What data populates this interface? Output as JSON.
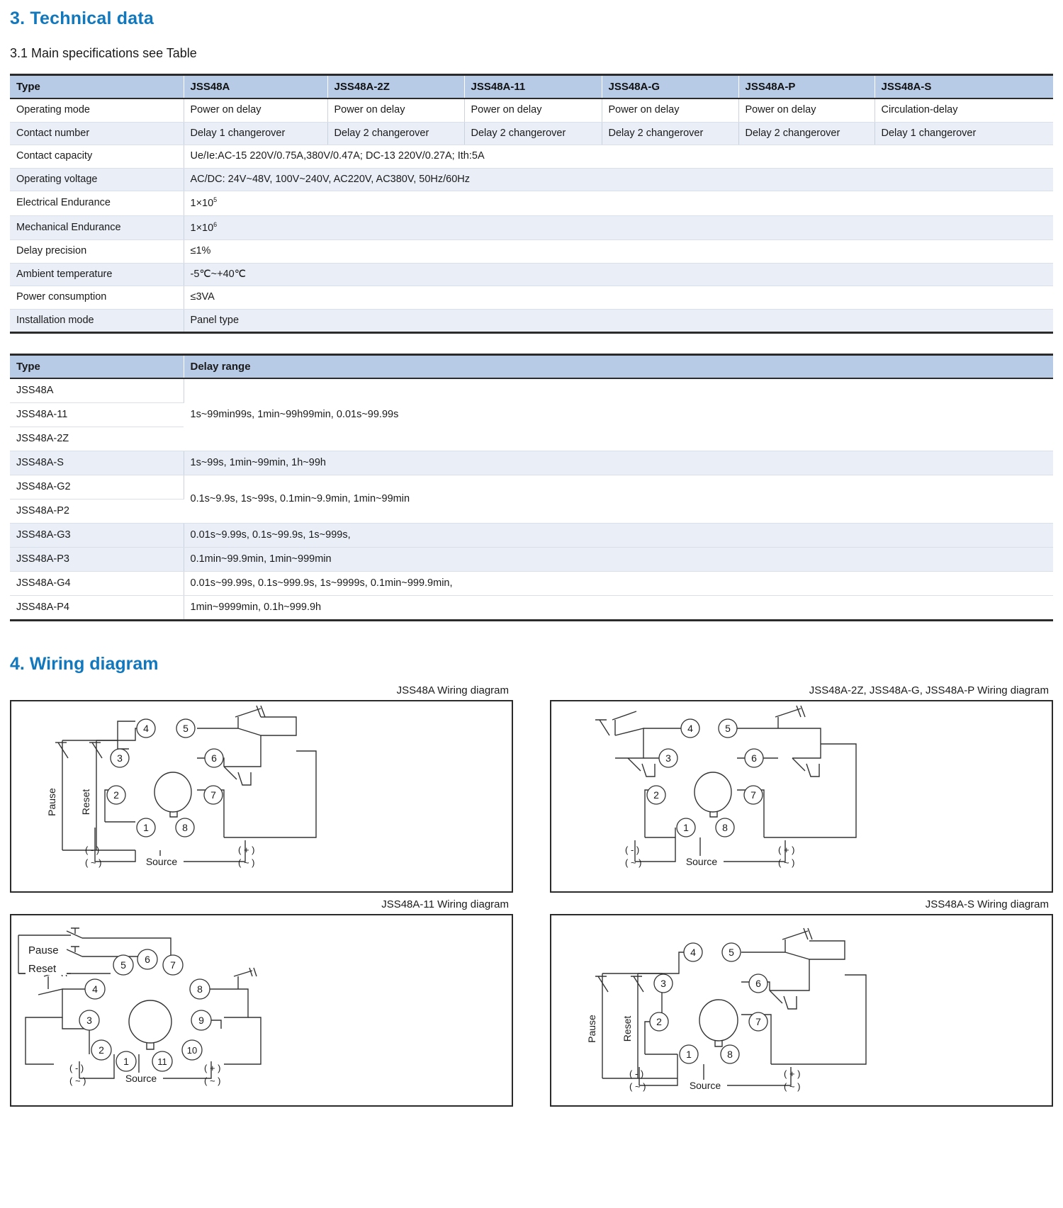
{
  "section3": {
    "title": "3. Technical data",
    "subtitle": "3.1 Main specifications see Table"
  },
  "spec_table": {
    "headers": [
      "Type",
      "JSS48A",
      "JSS48A-2Z",
      "JSS48A-11",
      "JSS48A-G",
      "JSS48A-P",
      "JSS48A-S"
    ],
    "rows": [
      {
        "label": "Operating mode",
        "cells": [
          "Power on delay",
          "Power on delay",
          "Power on delay",
          "Power on delay",
          "Power on delay",
          "Circulation-delay"
        ]
      },
      {
        "label": "Contact number",
        "cells": [
          "Delay 1 changerover",
          "Delay 2 changerover",
          "Delay 2 changerover",
          "Delay 2 changerover",
          "Delay 2 changerover",
          "Delay 1 changerover"
        ]
      },
      {
        "label": "Contact capacity",
        "span": "Ue/Ie:AC-15 220V/0.75A,380V/0.47A; DC-13 220V/0.27A; Ith:5A"
      },
      {
        "label": "Operating voltage",
        "span": "AC/DC: 24V~48V, 100V~240V, AC220V, AC380V, 50Hz/60Hz"
      },
      {
        "label": "Electrical Endurance",
        "span_html": "1×10",
        "sup": "5"
      },
      {
        "label": "Mechanical Endurance",
        "span_html": "1×10",
        "sup": "6"
      },
      {
        "label": "Delay precision",
        "span": "≤1%"
      },
      {
        "label": "Ambient temperature",
        "span": "-5℃~+40℃"
      },
      {
        "label": "Power consumption",
        "span": "≤3VA"
      },
      {
        "label": "Installation mode",
        "span": "Panel type"
      }
    ]
  },
  "delay_table": {
    "headers": [
      "Type",
      "Delay range"
    ],
    "rows": [
      {
        "type": "JSS48A",
        "range": ""
      },
      {
        "type": "JSS48A-11",
        "range": "1s~99min99s, 1min~99h99min, 0.01s~99.99s"
      },
      {
        "type": "JSS48A-2Z",
        "range": ""
      },
      {
        "type": "JSS48A-S",
        "range": "1s~99s, 1min~99min, 1h~99h"
      },
      {
        "type": "JSS48A-G2",
        "range": ""
      },
      {
        "type": "JSS48A-P2",
        "range": "0.1s~9.9s, 1s~99s, 0.1min~9.9min, 1min~99min"
      },
      {
        "type": "JSS48A-G3",
        "range": "0.01s~9.99s, 0.1s~99.9s, 1s~999s,"
      },
      {
        "type": "JSS48A-P3",
        "range": "0.1min~99.9min, 1min~999min"
      },
      {
        "type": "JSS48A-G4",
        "range": "0.01s~99.99s, 0.1s~999.9s, 1s~9999s, 0.1min~999.9min,"
      },
      {
        "type": "JSS48A-P4",
        "range": "1min~9999min, 0.1h~999.9h"
      }
    ]
  },
  "section4": {
    "title": "4. Wiring diagram",
    "diagrams": [
      {
        "caption": "JSS48A Wiring diagram",
        "pins": [
          "1",
          "2",
          "3",
          "4",
          "5",
          "6",
          "7",
          "8"
        ],
        "labels": {
          "pause": "Pause",
          "reset": "Reset",
          "source": "Source",
          "left_minus": "( - )",
          "left_ac": "( ~ )",
          "right_plus": "( + )",
          "right_ac": "( ~ )"
        }
      },
      {
        "caption": "JSS48A-2Z, JSS48A-G, JSS48A-P Wiring diagram",
        "pins": [
          "1",
          "2",
          "3",
          "4",
          "5",
          "6",
          "7",
          "8"
        ],
        "labels": {
          "source": "Source",
          "left_minus": "( - )",
          "left_ac": "( ~ )",
          "right_plus": "( + )",
          "right_ac": "( ~ )"
        }
      },
      {
        "caption": "JSS48A-11 Wiring diagram",
        "pins": [
          "1",
          "2",
          "3",
          "4",
          "5",
          "6",
          "7",
          "8",
          "9",
          "10",
          "11"
        ],
        "labels": {
          "pause": "Pause",
          "reset": "Reset",
          "source": "Source",
          "left_minus": "( - )",
          "left_ac": "( ~ )",
          "right_plus": "( + )",
          "right_ac": "( ~ )"
        }
      },
      {
        "caption": "JSS48A-S Wiring diagram",
        "pins": [
          "1",
          "2",
          "3",
          "4",
          "5",
          "6",
          "7",
          "8"
        ],
        "labels": {
          "pause": "Pause",
          "reset": "Reset",
          "source": "Source",
          "left_minus": "( - )",
          "left_ac": "( ~ )",
          "right_plus": "( + )",
          "right_ac": "( ~ )"
        }
      }
    ]
  },
  "colors": {
    "heading_blue": "#1278be",
    "table_header_bg": "#b8cbe6",
    "row_alt_bg": "#e9eef7",
    "rule": "#2b2b2b"
  }
}
